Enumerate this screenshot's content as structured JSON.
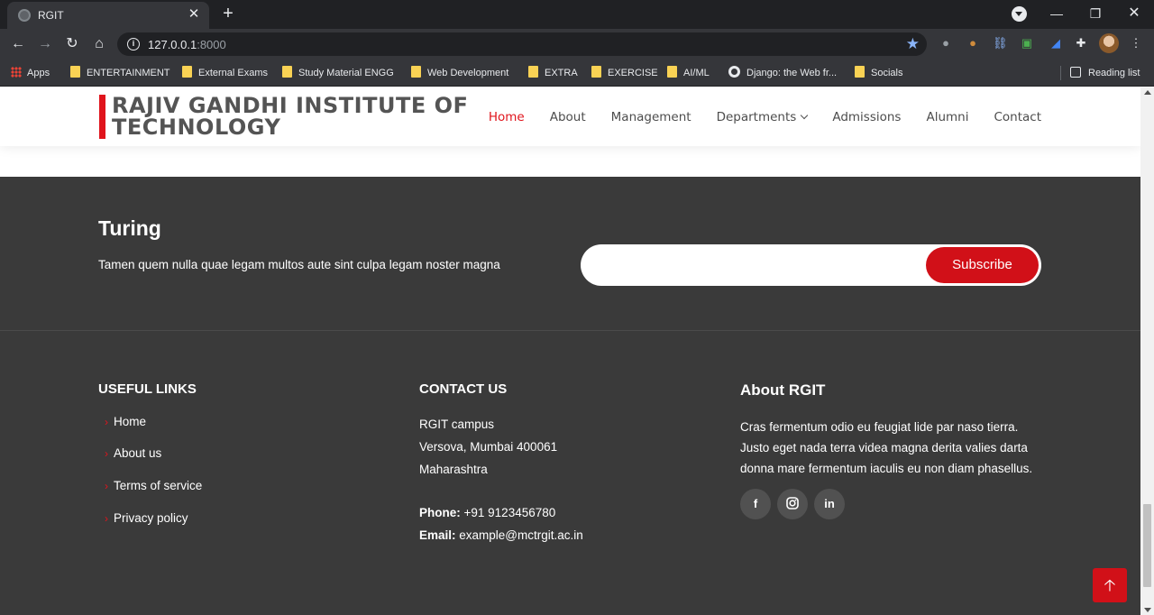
{
  "browser": {
    "tab_title": "RGIT",
    "url_host": "127.0.0.1",
    "url_port": ":8000",
    "bookmarks": [
      {
        "label": "Apps",
        "icon": "apps-grid-icon"
      },
      {
        "label": "ENTERTAINMENT",
        "icon": "folder-icon"
      },
      {
        "label": "External Exams",
        "icon": "folder-icon"
      },
      {
        "label": "Study Material ENGG",
        "icon": "folder-icon"
      },
      {
        "label": "Web Development",
        "icon": "folder-icon"
      },
      {
        "label": "EXTRA",
        "icon": "folder-icon"
      },
      {
        "label": "EXERCISE",
        "icon": "folder-icon"
      },
      {
        "label": "AI/ML",
        "icon": "folder-icon"
      },
      {
        "label": "Django: the Web fr...",
        "icon": "globe-icon"
      },
      {
        "label": "Socials",
        "icon": "folder-icon"
      }
    ],
    "reading_list": "Reading list"
  },
  "header": {
    "logo_line1": "RAJIV GANDHI INSTITUTE OF",
    "logo_line2": "TECHNOLOGY",
    "nav": [
      "Home",
      "About",
      "Management",
      "Departments",
      "Admissions",
      "Alumni",
      "Contact"
    ],
    "active": "Home"
  },
  "newsletter": {
    "title": "Turing",
    "text": "Tamen quem nulla quae legam multos aute sint culpa legam noster magna",
    "button": "Subscribe"
  },
  "footer": {
    "links_title": "USEFUL LINKS",
    "links": [
      "Home",
      "About us",
      "Terms of service",
      "Privacy policy"
    ],
    "contact_title": "CONTACT US",
    "address": [
      "RGIT campus",
      "Versova, Mumbai 400061",
      "Maharashtra"
    ],
    "phone_label": "Phone:",
    "phone": "+91 9123456780",
    "email_label": "Email:",
    "email": "example@mctrgit.ac.in",
    "about_title": "About RGIT",
    "about_text": "Cras fermentum odio eu feugiat lide par naso tierra. Justo eget nada terra videa magna derita valies darta donna mare fermentum iaculis eu non diam phasellus.",
    "social": [
      "facebook-icon",
      "instagram-icon",
      "linkedin-icon"
    ]
  },
  "colors": {
    "accent": "#d11018",
    "footer_bg": "#3a3a3a",
    "chrome_bg": "#35363a"
  }
}
